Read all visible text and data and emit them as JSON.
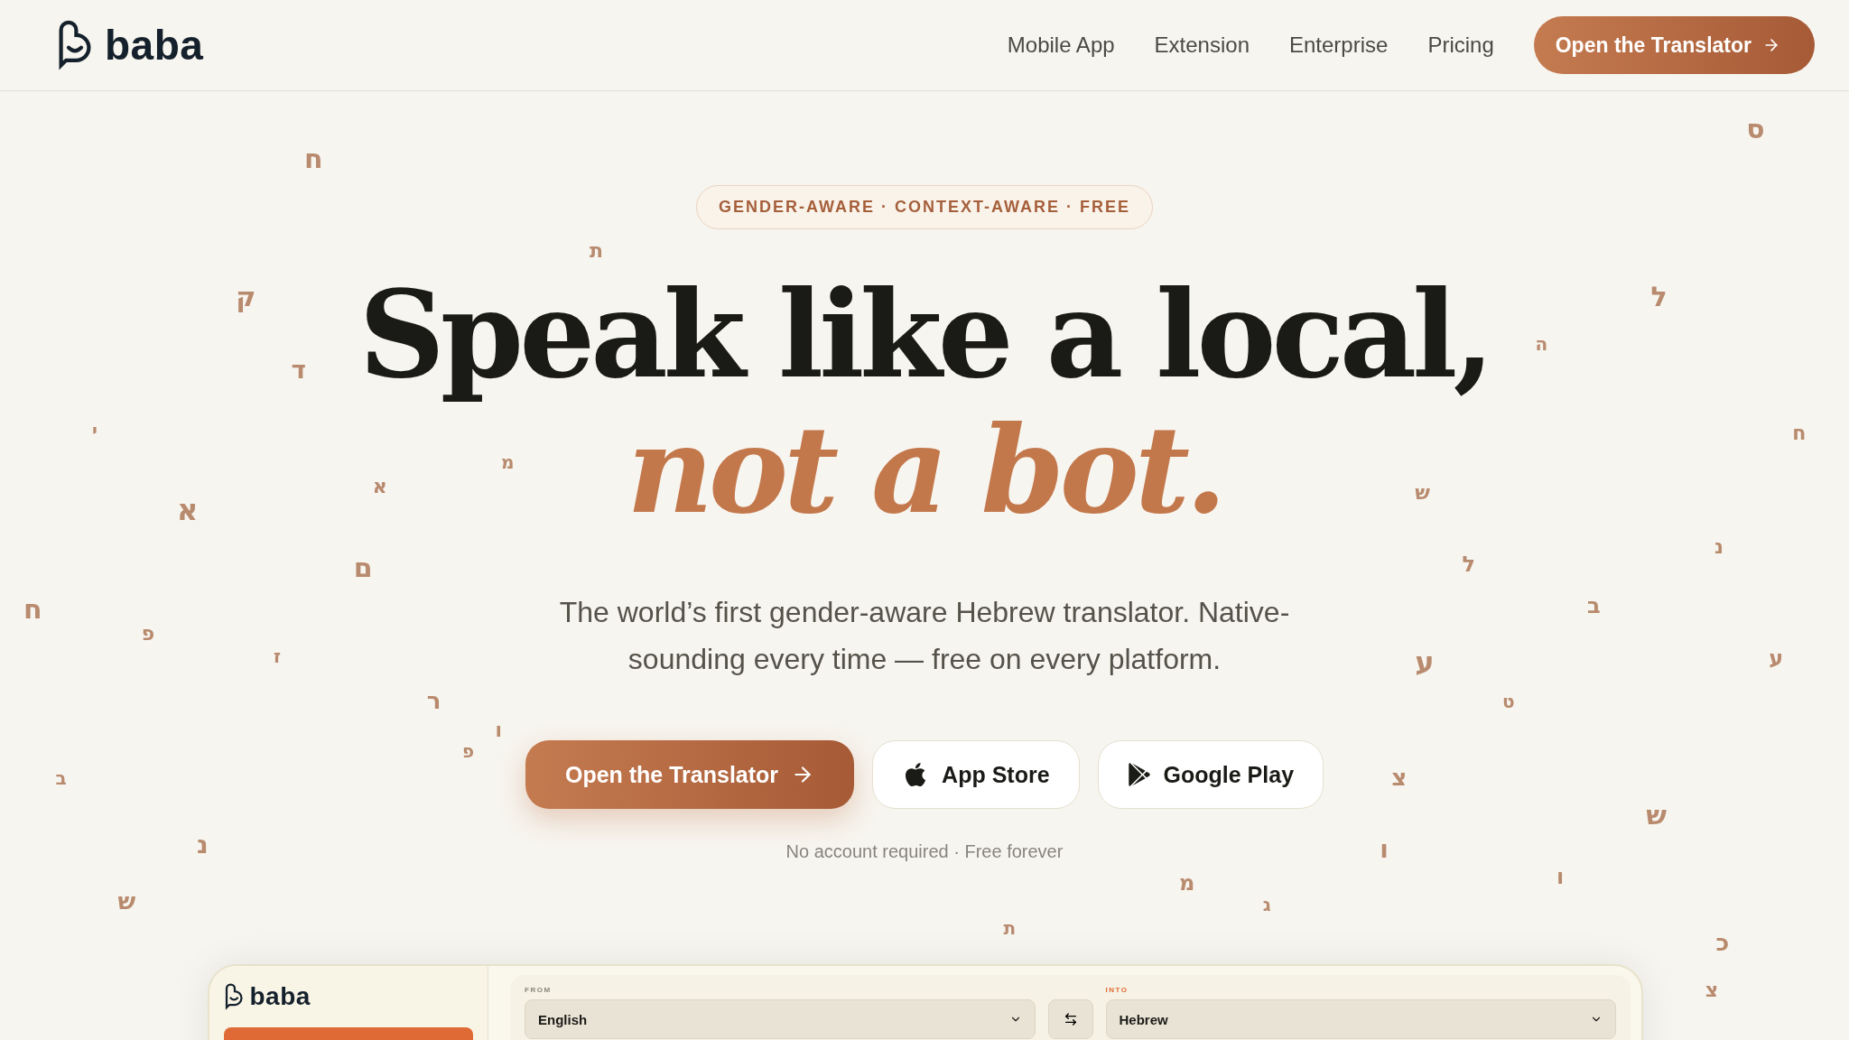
{
  "header": {
    "logo": "baba",
    "nav": [
      "Mobile App",
      "Extension",
      "Enterprise",
      "Pricing"
    ],
    "cta": "Open the Translator"
  },
  "hero": {
    "badge": "GENDER-AWARE · CONTEXT-AWARE · FREE",
    "headline": "Speak like a local,",
    "headline_accent": "not a bot.",
    "subtitle": "The world’s first gender-aware Hebrew translator. Native-sounding every time — free on every platform.",
    "buttons": [
      {
        "kind": "primary",
        "label": "Open the Translator"
      },
      {
        "kind": "apple",
        "label": "App Store"
      },
      {
        "kind": "google",
        "label": "Google Play"
      }
    ],
    "note": "No account required · Free forever"
  },
  "floating_letters": [
    "ח",
    "ס",
    "ת",
    "ד",
    "ה",
    "ק",
    "י",
    "ל",
    "א",
    "מ",
    "ח",
    "א",
    "ע",
    "נ",
    "ש",
    "ל",
    "ב",
    "ח",
    "פ",
    "ז",
    "ר",
    "ו",
    "ם",
    "ע",
    "ט",
    "ו",
    "צ",
    "פ",
    "ב",
    "ש",
    "מ",
    "נ",
    "ש",
    "ו",
    "ג",
    "כ",
    "ת",
    "צ"
  ],
  "preview": {
    "logo": "baba",
    "from_label": "FROM",
    "from_value": "English",
    "into_label": "INTO",
    "into_value": "Hebrew"
  }
}
